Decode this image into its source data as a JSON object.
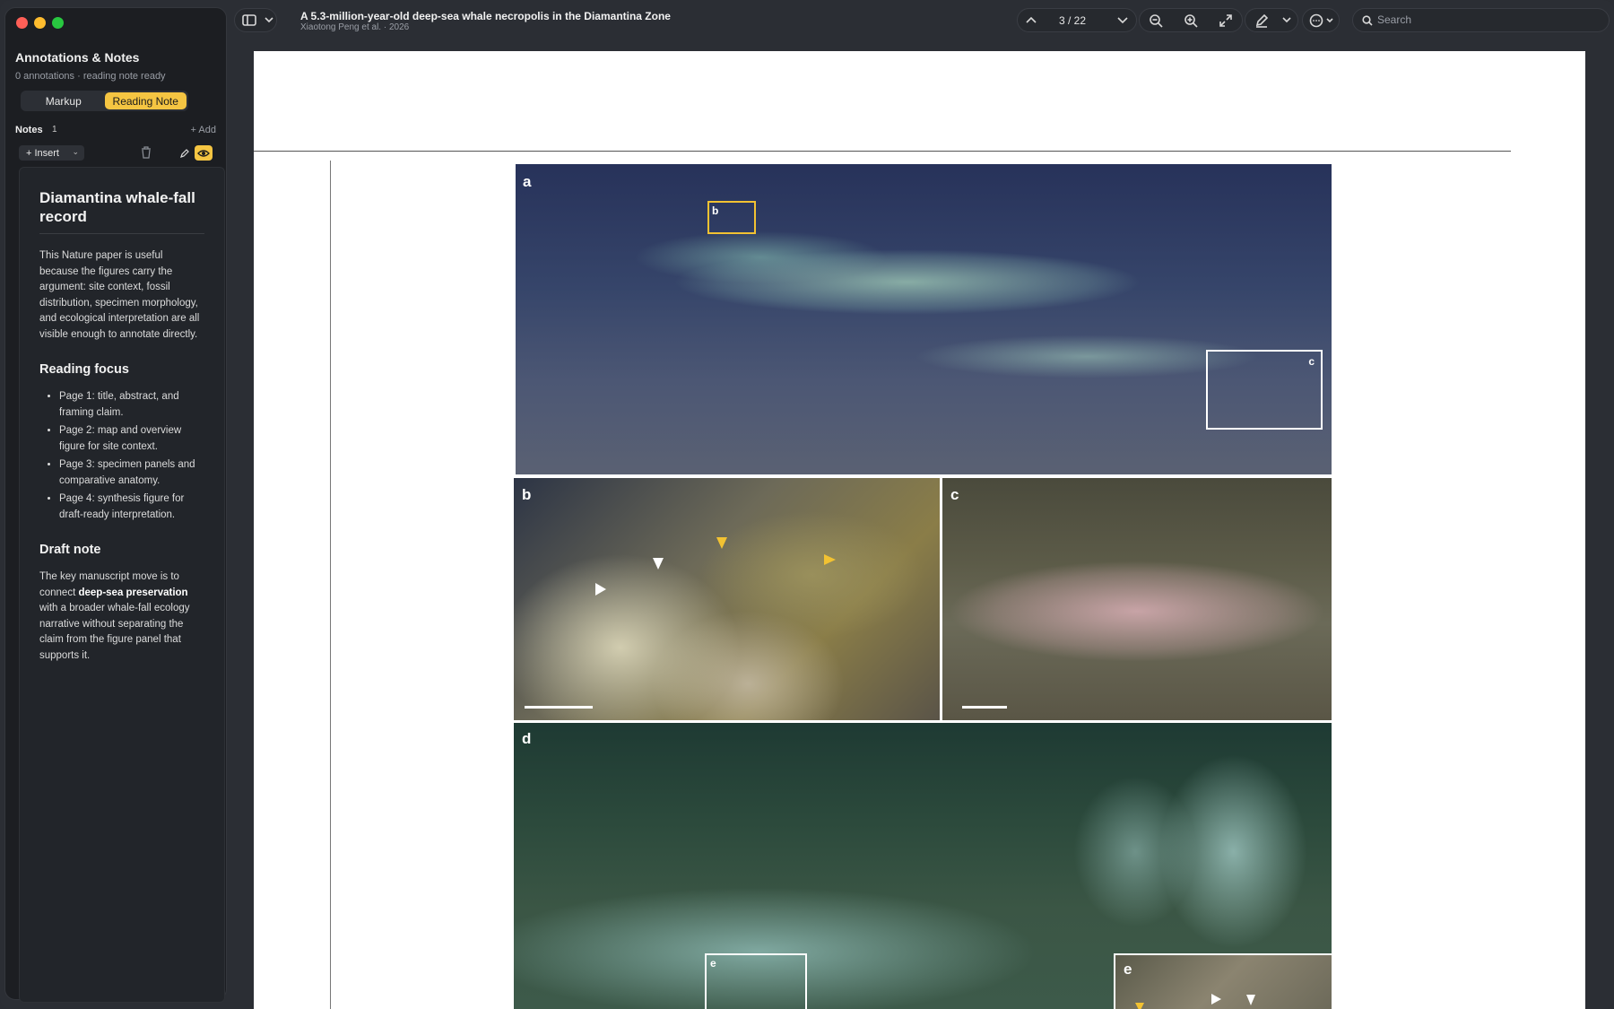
{
  "window": {
    "controls": [
      "close",
      "minimize",
      "zoom"
    ]
  },
  "sidebar": {
    "title": "Annotations & Notes",
    "subtitle": "0 annotations · reading note ready",
    "segments": [
      {
        "label": "Markup",
        "active": false
      },
      {
        "label": "Reading Note",
        "active": true
      }
    ],
    "notes_label": "Notes",
    "notes_count": "1",
    "add_label": "+ Add",
    "insert_label": "+ Insert",
    "note": {
      "title": "Diamantina whale-fall record",
      "intro": "This Nature paper is useful because the figures carry the argument: site context, fossil distribution, specimen morphology, and ecological interpretation are all visible enough to annotate directly.",
      "focus_heading": "Reading focus",
      "focus_items": [
        "Page 1: title, abstract, and framing claim.",
        "Page 2: map and overview figure for site context.",
        "Page 3: specimen panels and comparative anatomy.",
        "Page 4: synthesis figure for draft-ready interpretation."
      ],
      "draft_heading": "Draft note",
      "draft_pre": "The key manuscript move is to connect ",
      "draft_bold": "deep-sea preservation",
      "draft_post": " with a broader whale-fall ecology narrative without separating the claim from the figure panel that supports it."
    }
  },
  "toolbar": {
    "doc_title": "A 5.3-million-year-old deep-sea whale necropolis in the Diamantina Zone",
    "doc_subtitle": "Xiaotong Peng et al. · 2026",
    "page_indicator": "3 / 22",
    "search_placeholder": "Search",
    "accent_color": "#f5c542"
  },
  "figure": {
    "panels": {
      "a": "a",
      "b": "b",
      "c": "c",
      "d": "d",
      "e": "e"
    },
    "box_labels": {
      "b": "b",
      "c": "c",
      "e": "e"
    }
  }
}
